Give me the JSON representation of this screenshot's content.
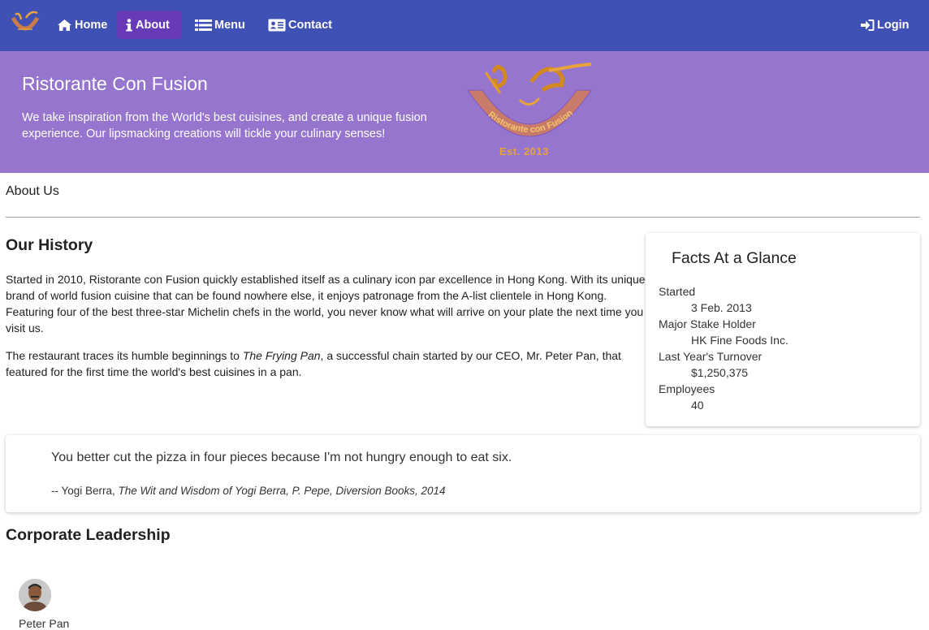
{
  "nav": {
    "home": "Home",
    "about": "About",
    "menu": "Menu",
    "contact": "Contact",
    "login": "Login",
    "active": "About",
    "colors": {
      "toolbar": "#3f51b5",
      "active": "#673ab7"
    }
  },
  "jumbotron": {
    "title": "Ristorante Con Fusion",
    "text": "We take inspiration from the World's best cuisines, and create a unique fusion experience. Our lipsmacking creations will tickle your culinary senses!",
    "logo_arc_text": "Ristorante con Fusion",
    "logo_est": "Est. 2013",
    "color": "#9575cd"
  },
  "breadcrumb": {
    "label": "About Us"
  },
  "history": {
    "title": "Our History",
    "p1": "Started in 2010, Ristorante con Fusion quickly established itself as a culinary icon par excellence in Hong Kong. With its unique brand of world fusion cuisine that can be found nowhere else, it enjoys patronage from the A-list clientele in Hong Kong. Featuring four of the best three-star Michelin chefs in the world, you never know what will arrive on your plate the next time you visit us.",
    "p2_before": "The restaurant traces its humble beginnings to ",
    "p2_italic": "The Frying Pan",
    "p2_after": ", a successful chain started by our CEO, Mr. Peter Pan, that featured for the first time the world's best cuisines in a pan."
  },
  "facts": {
    "title": "Facts At a Glance",
    "items": [
      {
        "label": "Started",
        "value": "3 Feb. 2013"
      },
      {
        "label": "Major Stake Holder",
        "value": "HK Fine Foods Inc."
      },
      {
        "label": "Last Year's Turnover",
        "value": "$1,250,375"
      },
      {
        "label": "Employees",
        "value": "40"
      }
    ]
  },
  "quote": {
    "text": "You better cut the pizza in four pieces because I'm not hungry enough to eat six.",
    "author": "-- Yogi Berra, ",
    "source": "The Wit and Wisdom of Yogi Berra, P. Pepe, Diversion Books, 2014"
  },
  "leadership": {
    "title": "Corporate Leadership",
    "leaders": [
      {
        "name": "Peter Pan"
      }
    ]
  }
}
